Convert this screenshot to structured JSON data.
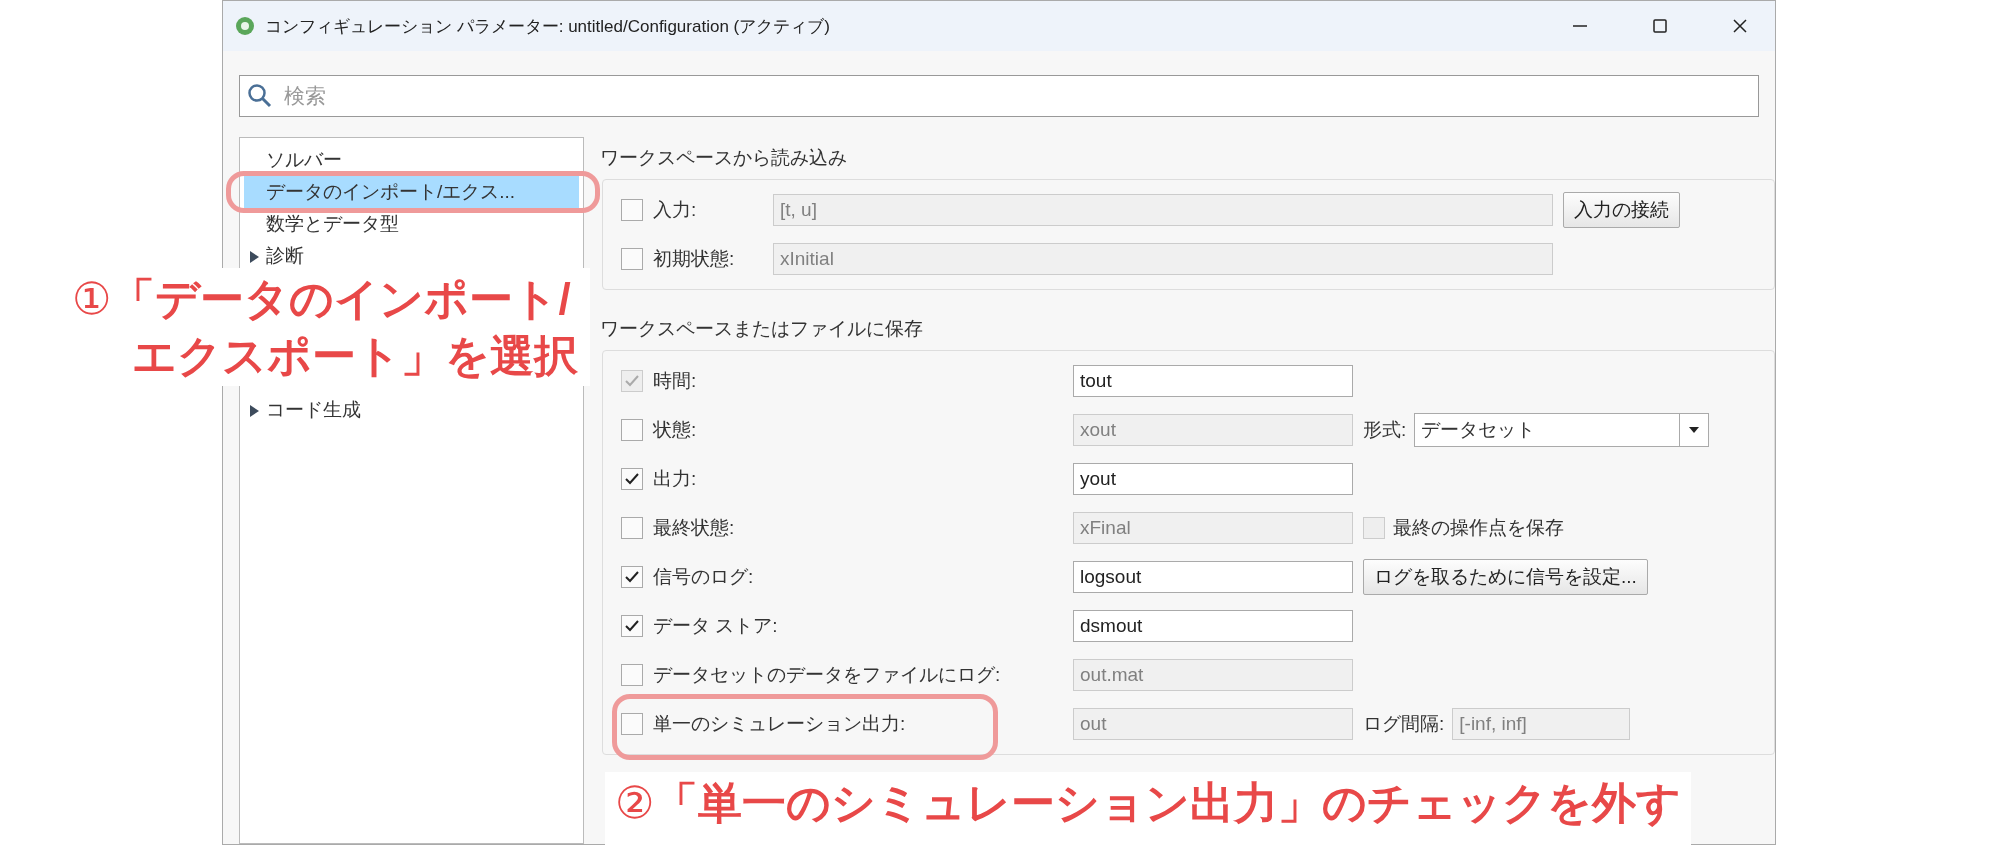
{
  "window": {
    "title": "コンフィギュレーション パラメーター: untitled/Configuration (アクティブ)"
  },
  "search": {
    "placeholder": "検索"
  },
  "sidebar": {
    "items": [
      {
        "label": "ソルバー",
        "selected": false,
        "kind": "leaf"
      },
      {
        "label": "データのインポート/エクス...",
        "selected": true,
        "kind": "leaf"
      },
      {
        "label": "数学とデータ型",
        "selected": false,
        "kind": "leaf"
      },
      {
        "label": "診断",
        "selected": false,
        "kind": "group"
      },
      {
        "label": "コード生成",
        "selected": false,
        "kind": "group"
      }
    ]
  },
  "sections": [
    {
      "title": "ワークスペースから読み込み",
      "rows": [
        {
          "label": "入力:",
          "checked": false,
          "disabled": false,
          "value": "[t, u]",
          "field_enabled": false,
          "extra": {
            "kind": "button",
            "label": "入力の接続"
          }
        },
        {
          "label": "初期状態:",
          "checked": false,
          "disabled": false,
          "value": "xInitial",
          "field_enabled": false
        }
      ]
    },
    {
      "title": "ワークスペースまたはファイルに保存",
      "rows": [
        {
          "label": "時間:",
          "checked": true,
          "disabled": true,
          "value": "tout",
          "field_enabled": true
        },
        {
          "label": "状態:",
          "checked": false,
          "disabled": false,
          "value": "xout",
          "field_enabled": false,
          "extra": {
            "kind": "dropdown",
            "label": "形式:",
            "value": "データセット"
          }
        },
        {
          "label": "出力:",
          "checked": true,
          "disabled": false,
          "value": "yout",
          "field_enabled": true
        },
        {
          "label": "最終状態:",
          "checked": false,
          "disabled": false,
          "value": "xFinal",
          "field_enabled": false,
          "extra": {
            "kind": "checkbox",
            "label": "最終の操作点を保存",
            "checked": false
          }
        },
        {
          "label": "信号のログ:",
          "checked": true,
          "disabled": false,
          "value": "logsout",
          "field_enabled": true,
          "extra": {
            "kind": "button",
            "label": "ログを取るために信号を設定..."
          }
        },
        {
          "label": "データ ストア:",
          "checked": true,
          "disabled": false,
          "value": "dsmout",
          "field_enabled": true
        },
        {
          "label": "データセットのデータをファイルにログ:",
          "checked": false,
          "disabled": false,
          "value": "out.mat",
          "field_enabled": false
        },
        {
          "label": "単一のシミュレーション出力:",
          "checked": false,
          "disabled": false,
          "value": "out",
          "field_enabled": false,
          "extra": {
            "kind": "field",
            "label": "ログ間隔:",
            "value": "[-inf, inf]"
          }
        }
      ]
    }
  ],
  "annotations": [
    {
      "number": "①",
      "lines": [
        "「データのインポート/",
        "エクスポート」を選択"
      ]
    },
    {
      "number": "②",
      "lines": [
        "「単一のシミュレーション出力」のチェックを外す"
      ]
    }
  ]
}
